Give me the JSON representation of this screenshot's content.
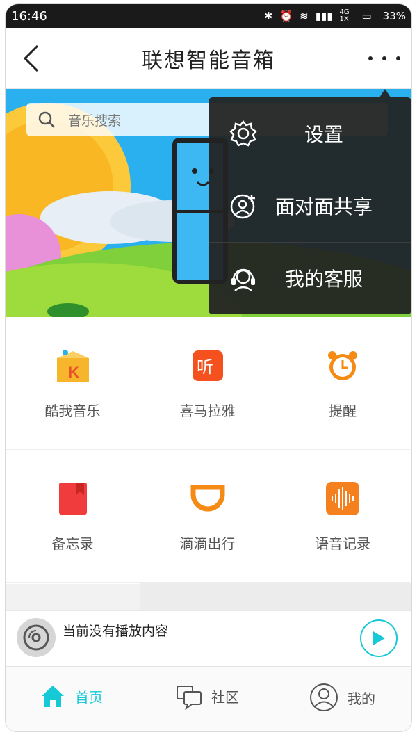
{
  "status_bar": {
    "time": "16:46",
    "network": "4G 1X",
    "battery": "33%"
  },
  "header": {
    "title": "联想智能音箱",
    "back_icon": "back-arrow-icon",
    "more_icon": "more-dots-icon"
  },
  "search": {
    "placeholder": "音乐搜索"
  },
  "grid": {
    "items": [
      {
        "label": "酷我音乐",
        "icon": "kuwo-music-icon",
        "color": "#f59b1c"
      },
      {
        "label": "喜马拉雅",
        "icon": "ximalaya-icon",
        "color": "#f4511e"
      },
      {
        "label": "提醒",
        "icon": "alarm-clock-icon",
        "color": "#f58a14"
      },
      {
        "label": "备忘录",
        "icon": "memo-bookmark-icon",
        "color": "#f03c3c"
      },
      {
        "label": "滴滴出行",
        "icon": "didi-icon",
        "color": "#f58a14"
      },
      {
        "label": "语音记录",
        "icon": "voice-record-icon",
        "color": "#f5801e"
      }
    ]
  },
  "player": {
    "status": "当前没有播放内容",
    "accent": "#15c9d6"
  },
  "tabs": [
    {
      "label": "首页",
      "icon": "home-icon",
      "active": true
    },
    {
      "label": "社区",
      "icon": "community-chat-icon",
      "active": false
    },
    {
      "label": "我的",
      "icon": "profile-icon",
      "active": false
    }
  ],
  "menu": {
    "items": [
      {
        "label": "设置",
        "icon": "gear-icon"
      },
      {
        "label": "面对面共享",
        "icon": "face-share-icon"
      },
      {
        "label": "我的客服",
        "icon": "headset-service-icon"
      }
    ]
  },
  "colors": {
    "accent": "#15c9d6",
    "menu_bg": "#222222"
  }
}
